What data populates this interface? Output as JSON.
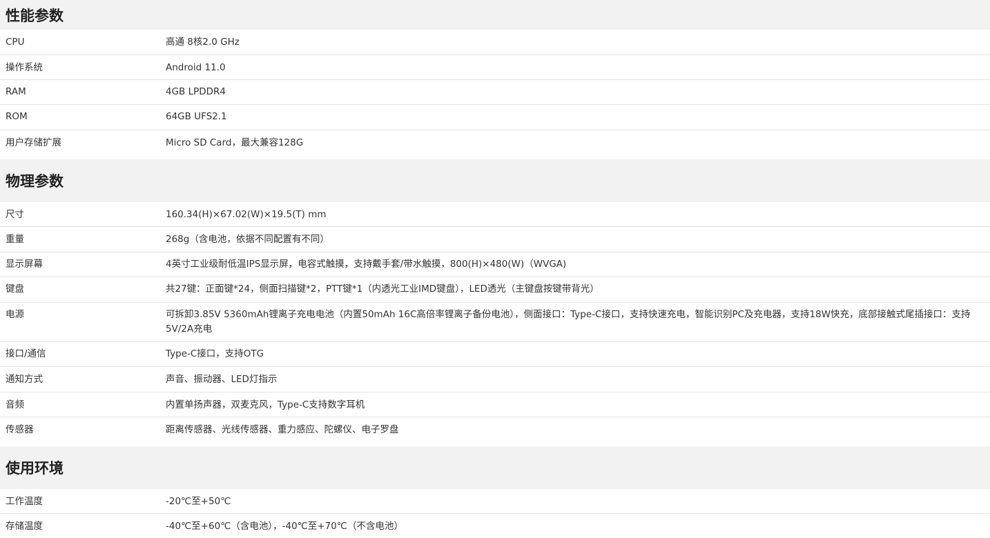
{
  "sections": [
    {
      "title": "性能参数",
      "rows": [
        {
          "label": "CPU",
          "value": "高通 8核2.0 GHz"
        },
        {
          "label": "操作系统",
          "value": "Android 11.0"
        },
        {
          "label": "RAM",
          "value": "4GB LPDDR4"
        },
        {
          "label": "ROM",
          "value": "64GB UFS2.1"
        },
        {
          "label": "用户存储扩展",
          "value": "Micro SD Card，最大兼容128G"
        }
      ]
    },
    {
      "title": "物理参数",
      "rows": [
        {
          "label": "尺寸",
          "value": "160.34(H)×67.02(W)×19.5(T) mm"
        },
        {
          "label": "重量",
          "value": "268g（含电池，依据不同配置有不同）"
        },
        {
          "label": "显示屏幕",
          "value": "4英寸工业级耐低温IPS显示屏，电容式触摸，支持戴手套/带水触摸，800(H)×480(W)（WVGA)"
        },
        {
          "label": "键盘",
          "value": "共27键：正面键*24，侧面扫描键*2，PTT键*1（内透光工业IMD键盘），LED透光（主键盘按键带背光）"
        },
        {
          "label": "电源",
          "value": "可拆卸3.85V 5360mAh锂离子充电电池（内置50mAh 16C高倍率锂离子备份电池），侧面接口：Type-C接口，支持快速充电，智能识别PC及充电器，支持18W快充，底部接触式尾插接口：支持5V/2A充电"
        },
        {
          "label": "接口/通信",
          "value": "Type-C接口，支持OTG"
        },
        {
          "label": "通知方式",
          "value": "声音、振动器、LED灯指示"
        },
        {
          "label": "音频",
          "value": "内置单扬声器，双麦克风，Type-C支持数字耳机"
        },
        {
          "label": "传感器",
          "value": "距离传感器、光线传感器、重力感应、陀螺仪、电子罗盘"
        }
      ]
    },
    {
      "title": "使用环境",
      "rows": [
        {
          "label": "工作温度",
          "value": "-20℃至+50℃"
        },
        {
          "label": "存储温度",
          "value": "-40℃至+60℃（含电池），-40℃至+70℃（不含电池）"
        }
      ]
    }
  ]
}
